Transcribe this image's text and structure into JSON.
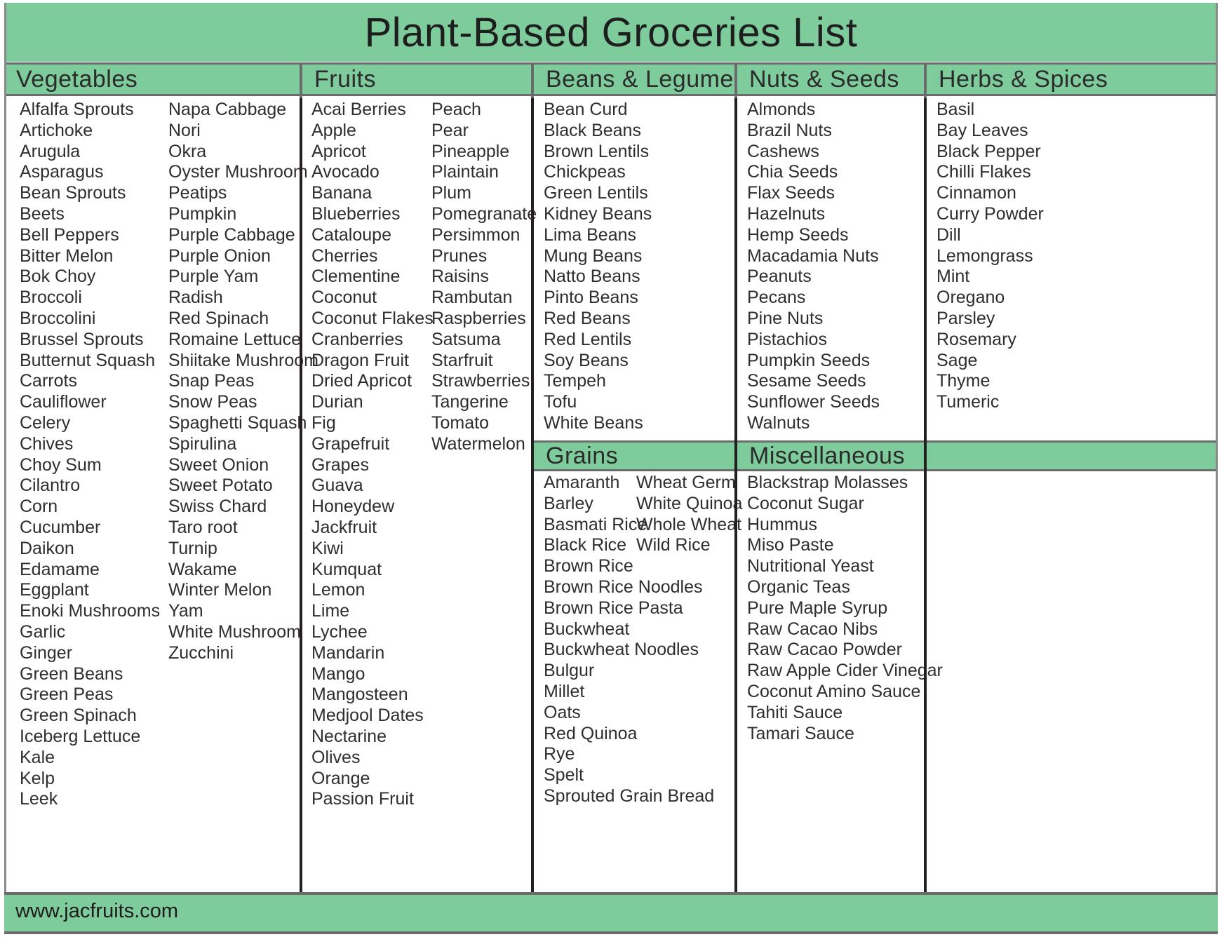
{
  "title": "Plant-Based Groceries List",
  "footer": {
    "website": "www.jacfruits.com"
  },
  "colors": {
    "accent_green": "#7ecb9c",
    "rule_gray": "#6b6b6b",
    "rule_dark": "#231f20",
    "text": "#2e2e2e",
    "page_background": "#ffffff"
  },
  "sections": {
    "vegetables": {
      "header": "Vegetables",
      "col1": [
        "Alfalfa Sprouts",
        "Artichoke",
        "Arugula",
        "Asparagus",
        "Bean Sprouts",
        "Beets",
        "Bell Peppers",
        "Bitter Melon",
        "Bok Choy",
        "Broccoli",
        "Broccolini",
        "Brussel Sprouts",
        "Butternut Squash",
        "Carrots",
        "Cauliflower",
        "Celery",
        "Chives",
        "Choy Sum",
        "Cilantro",
        "Corn",
        "Cucumber",
        "Daikon",
        "Edamame",
        "Eggplant",
        "Enoki Mushrooms",
        "Garlic",
        "Ginger",
        "Green Beans",
        "Green Peas",
        "Green Spinach",
        "Iceberg Lettuce",
        "Kale",
        "Kelp",
        "Leek"
      ],
      "col2": [
        "Napa Cabbage",
        "Nori",
        "Okra",
        "Oyster Mushroom",
        "Peatips",
        "Pumpkin",
        "Purple Cabbage",
        "Purple Onion",
        "Purple Yam",
        "Radish",
        "Red Spinach",
        "Romaine Lettuce",
        "Shiitake Mushroom",
        "Snap Peas",
        "Snow Peas",
        "Spaghetti Squash",
        "Spirulina",
        "Sweet Onion",
        "Sweet Potato",
        "Swiss Chard",
        "Taro root",
        "Turnip",
        "Wakame",
        "Winter Melon",
        "Yam",
        "White Mushroom",
        "Zucchini"
      ]
    },
    "fruits": {
      "header": "Fruits",
      "col1": [
        "Acai Berries",
        "Apple",
        "Apricot",
        "Avocado",
        "Banana",
        "Blueberries",
        "Cataloupe",
        "Cherries",
        "Clementine",
        "Coconut",
        "Coconut Flakes",
        "Cranberries",
        "Dragon Fruit",
        "Dried Apricot",
        "Durian",
        "Fig",
        "Grapefruit",
        "Grapes",
        "Guava",
        "Honeydew",
        "Jackfruit",
        "Kiwi",
        "Kumquat",
        "Lemon",
        "Lime",
        "Lychee",
        "Mandarin",
        "Mango",
        "Mangosteen",
        "Medjool Dates",
        "Nectarine",
        "Olives",
        "Orange",
        "Passion Fruit"
      ],
      "col2": [
        "Peach",
        "Pear",
        "Pineapple",
        "Plaintain",
        "Plum",
        "Pomegranate",
        "Persimmon",
        "Prunes",
        "Raisins",
        "Rambutan",
        "Raspberries",
        "Satsuma",
        "Starfruit",
        "Strawberries",
        "Tangerine",
        "Tomato",
        "Watermelon"
      ]
    },
    "beans_legumes": {
      "header": "Beans & Legumes",
      "col1": [
        "Bean Curd",
        "Black Beans",
        "Brown Lentils",
        "Chickpeas",
        "Green Lentils",
        "Kidney Beans",
        "Lima Beans",
        "Mung Beans",
        "Natto Beans",
        "Pinto Beans",
        "Red Beans",
        "Red Lentils",
        "Soy Beans",
        "Tempeh",
        "Tofu",
        "White Beans"
      ]
    },
    "nuts_seeds": {
      "header": "Nuts & Seeds",
      "col1": [
        "Almonds",
        "Brazil Nuts",
        "Cashews",
        "Chia Seeds",
        "Flax Seeds",
        "Hazelnuts",
        "Hemp Seeds",
        "Macadamia Nuts",
        "Peanuts",
        "Pecans",
        "Pine Nuts",
        "Pistachios",
        "Pumpkin Seeds",
        "Sesame Seeds",
        "Sunflower Seeds",
        "Walnuts"
      ]
    },
    "herbs_spices": {
      "header": "Herbs & Spices",
      "col1": [
        "Basil",
        "Bay Leaves",
        "Black Pepper",
        "Chilli Flakes",
        "Cinnamon",
        "Curry Powder",
        "Dill",
        "Lemongrass",
        "Mint",
        "Oregano",
        "Parsley",
        "Rosemary",
        "Sage",
        "Thyme",
        "Tumeric"
      ]
    },
    "grains": {
      "header": "Grains",
      "col1": [
        "Amaranth",
        "Barley",
        "Basmati Rice",
        "Black Rice",
        "Brown Rice",
        "Brown Rice Noodles",
        "Brown Rice Pasta",
        "Buckwheat",
        "Buckwheat Noodles",
        "Bulgur",
        "Millet",
        "Oats",
        "Red Quinoa",
        "Rye",
        "Spelt",
        "Sprouted Grain Bread"
      ],
      "col2": [
        "Wheat Germ",
        "White Quinoa",
        "Whole Wheat",
        "Wild Rice"
      ]
    },
    "miscellaneous": {
      "header": "Miscellaneous",
      "col1": [
        "Blackstrap Molasses",
        "Coconut Sugar",
        "Hummus",
        "Miso Paste",
        "Nutritional Yeast",
        "Organic Teas",
        "Pure Maple Syrup",
        "Raw Cacao Nibs",
        "Raw Cacao Powder",
        "Raw Apple Cider Vinegar",
        "Coconut Amino Sauce",
        "Tahiti Sauce",
        "Tamari Sauce"
      ]
    }
  }
}
